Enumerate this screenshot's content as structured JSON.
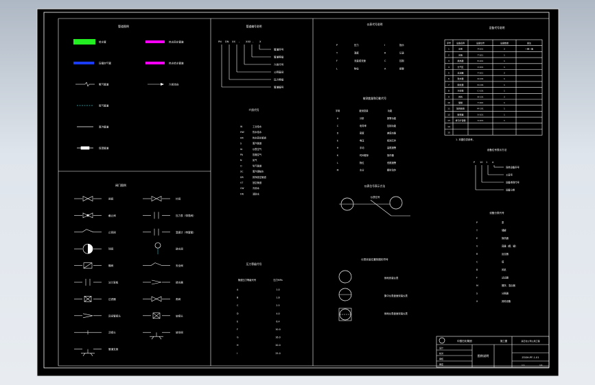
{
  "colors": {
    "background": "#000000",
    "line": "#ffffff",
    "green": "#22ee22",
    "blue": "#1a3cff",
    "magenta": "#ff00ff",
    "cyan": "#33c0c8",
    "viewport_bg": "#d8dfe7"
  },
  "legend_panel": {
    "title": "管道图例",
    "left": [
      {
        "icon": "green-bar-icon",
        "label": "给水管"
      },
      {
        "icon": "blue-bar-icon",
        "label": "压缩空气管"
      },
      {
        "icon": "break-line-icon",
        "label": "氧气管道"
      },
      {
        "icon": "dashed-line-icon",
        "label": "氮气管道"
      },
      {
        "icon": "solid-line-icon",
        "label": "蒸汽管道"
      },
      {
        "icon": "thick-line-icon",
        "label": "保温管道"
      }
    ],
    "right": [
      {
        "icon": "magenta-bar-icon",
        "label": "热水回水管道"
      },
      {
        "icon": "magenta-bar-icon",
        "label": "热水给水管道"
      },
      {
        "icon": "flow-arrow-icon",
        "label": "介质流向"
      }
    ]
  },
  "valve_panel": {
    "title": "阀门图例",
    "left": [
      {
        "icon": "gate-valve-icon",
        "label": "闸阀"
      },
      {
        "icon": "globe-valve-icon",
        "label": "截止阀"
      },
      {
        "icon": "check-valve-icon",
        "label": "止回阀"
      },
      {
        "icon": "ball-valve-icon",
        "label": "球阀"
      },
      {
        "icon": "butterfly-valve-icon",
        "label": "蝶阀"
      },
      {
        "icon": "blind-flange-icon",
        "label": "法兰盲板"
      },
      {
        "icon": "y-filter-icon",
        "label": "过滤器"
      },
      {
        "icon": "reducer-icon",
        "label": "异径管接头"
      },
      {
        "icon": "union-icon",
        "label": "活接头"
      },
      {
        "icon": "support-icon",
        "label": "管道支架"
      }
    ],
    "right": [
      {
        "icon": "needle-valve-icon",
        "label": "针阀"
      },
      {
        "icon": "pressure-gauge-icon",
        "label": "压力表（带表阀）"
      },
      {
        "icon": "thermometer-icon",
        "label": "温度计（带套管）"
      },
      {
        "icon": "drain-valve-icon",
        "label": "疏水阀"
      },
      {
        "icon": "safety-valve-icon",
        "label": "安全阀"
      },
      {
        "icon": "steam-trap-icon",
        "label": "疏水器"
      },
      {
        "icon": "angle-valve-icon",
        "label": "角阀"
      },
      {
        "icon": "flexible-joint-icon",
        "label": "软接头"
      },
      {
        "icon": "vent-icon",
        "label": "放空阀"
      }
    ]
  },
  "pipe_code": {
    "title": "管道编号说明",
    "code_parts": [
      "PN",
      "DN",
      "XX",
      "-",
      "XXX",
      "-",
      "X"
    ],
    "labels": [
      "管道序号",
      "管道等级",
      "介质代号",
      "公称直径",
      "压力等级",
      "管道编号"
    ],
    "media_title": "介质代号",
    "media": [
      {
        "code": "W",
        "name": "工业给水"
      },
      {
        "code": "HW",
        "name": "热水给水"
      },
      {
        "code": "HR",
        "name": "热水回水管道"
      },
      {
        "code": "S",
        "name": "蒸汽管道"
      },
      {
        "code": "IA",
        "name": "仪表空气"
      },
      {
        "code": "PA",
        "name": "压缩空气"
      },
      {
        "code": "N",
        "name": "氮气"
      },
      {
        "code": "O",
        "name": "氧气管道"
      },
      {
        "code": "SC",
        "name": "蒸汽凝结水"
      },
      {
        "code": "DR",
        "name": "排净放空管道"
      },
      {
        "code": "VT",
        "name": "放空管道"
      },
      {
        "code": "CW",
        "name": "冷却水"
      },
      {
        "code": "FW",
        "name": "消防水"
      }
    ],
    "pressure_title": "压力等级代号",
    "pressure_header": [
      "管道压力等级代号",
      "压力MPa"
    ],
    "pressure": [
      {
        "code": "A",
        "value": "1.0"
      },
      {
        "code": "B",
        "value": "1.6"
      },
      {
        "code": "C",
        "value": "2.5"
      },
      {
        "code": "D",
        "value": "4.0"
      },
      {
        "code": "E",
        "value": "6.4"
      },
      {
        "code": "F",
        "value": "10.0"
      },
      {
        "code": "G",
        "value": "16.0"
      },
      {
        "code": "H",
        "value": "20.0"
      },
      {
        "code": "I",
        "value": "25.0"
      }
    ]
  },
  "instruments": {
    "title": "仪表代号说明",
    "letters": [
      {
        "l1": "P",
        "t1": "压力",
        "l2": "I",
        "t2": "指示"
      },
      {
        "l1": "T",
        "t1": "温度",
        "l2": "R",
        "t2": "记录"
      },
      {
        "l1": "F",
        "t1": "流量或流速",
        "l2": "C",
        "t2": "控制"
      },
      {
        "l1": "L",
        "t1": "物位",
        "l2": "A",
        "t2": "报警"
      }
    ],
    "func_title": "被测变量和功能代号",
    "func_header": [
      "字母",
      "被测变量",
      "功能"
    ],
    "funcs": [
      {
        "a": "A",
        "b": "分析",
        "c": "报警功能"
      },
      {
        "a": "C",
        "b": "电导率",
        "c": "控制功能"
      },
      {
        "a": "D",
        "b": "密度",
        "c": "差值功能"
      },
      {
        "a": "E",
        "b": "电压",
        "c": "检测元件"
      },
      {
        "a": "H",
        "b": "手动",
        "c": "高限报警"
      },
      {
        "a": "K",
        "b": "时间程序",
        "c": "操作器"
      },
      {
        "a": "L",
        "b": "物位",
        "c": "低限报警"
      },
      {
        "a": "M",
        "b": "水分",
        "c": "瞬时动作"
      }
    ],
    "circle_title": "仪表位号表示方法",
    "circle_label": "仪表位号",
    "symbols_title": "仪表安装位置的图形符号",
    "symbols": [
      "就地安装仪表",
      "集中仪表盘面安装仪表",
      "就地仪表盘面安装仪表"
    ]
  },
  "equipment": {
    "title": "设备代号说明",
    "header": [
      "序号",
      "设备名称",
      "设备位号",
      "设备数量",
      "备注"
    ],
    "rows": [
      [
        "1",
        "水泵",
        "P-101",
        "2",
        "一用一备"
      ],
      [
        "2",
        "水箱",
        "T-101",
        "1",
        ""
      ],
      [
        "3",
        "换热器",
        "E-101",
        "1",
        ""
      ],
      [
        "4",
        "分汽缸",
        "V-101",
        "1",
        ""
      ],
      [
        "5",
        "过滤器",
        "F-101",
        "2",
        ""
      ],
      [
        "6",
        "软水器",
        "R-101",
        "1",
        ""
      ],
      [
        "7",
        "除氧器",
        "D-101",
        "1",
        ""
      ],
      [
        "8",
        "冷却塔",
        "C-101",
        "1",
        ""
      ],
      [
        "9",
        "风机",
        "B-101",
        "2",
        ""
      ],
      [
        "10",
        "储罐",
        "T-102",
        "1",
        ""
      ],
      [
        "11",
        "加药装置",
        "M-101",
        "1",
        ""
      ],
      [
        "12",
        "取样器",
        "S-101",
        "1",
        ""
      ],
      [
        "13",
        "排污扩容器",
        "X-101",
        "1",
        ""
      ],
      [
        "14",
        "",
        "",
        "",
        ""
      ],
      [
        "15",
        "",
        "",
        "",
        ""
      ]
    ],
    "note": "1. 本图仅供参考。",
    "tag_title": "设备位号表示方法",
    "tag_parts": [
      "P",
      "10",
      "1",
      "A"
    ],
    "tag_labels": [
      "同类设备序号",
      "工段号",
      "设备类别代号",
      "设备分类"
    ],
    "class_title": "设备分类代号",
    "classes": [
      {
        "code": "P",
        "name": "泵"
      },
      {
        "code": "T",
        "name": "储罐"
      },
      {
        "code": "E",
        "name": "换热器"
      },
      {
        "code": "V",
        "name": "容器（槽、罐）"
      },
      {
        "code": "R",
        "name": "反应器"
      },
      {
        "code": "C",
        "name": "塔"
      },
      {
        "code": "B",
        "name": "风机"
      },
      {
        "code": "F",
        "name": "过滤器"
      },
      {
        "code": "M",
        "name": "搅拌、混合器"
      },
      {
        "code": "S",
        "name": "分离器"
      },
      {
        "code": "X",
        "name": "其他设备"
      }
    ]
  },
  "title_block": {
    "company": "中国石化集团",
    "project": "某石化公司公用工程",
    "drawing_name": "图例说明",
    "drawing_no": "ZGSH-PF-1-01",
    "stage": "施工图",
    "rows": [
      "设计",
      "校对",
      "审核",
      "审定"
    ],
    "scale": "1:1",
    "sheet": "1/1"
  }
}
